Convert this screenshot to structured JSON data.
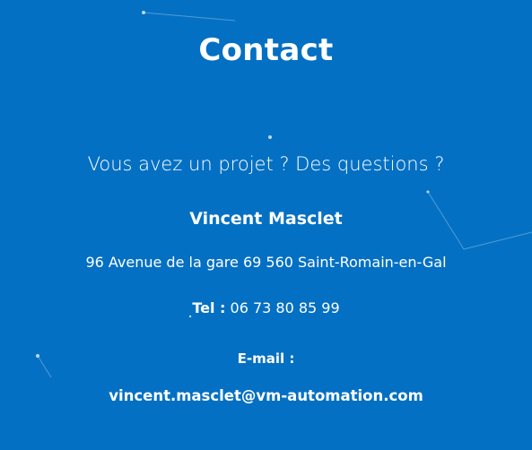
{
  "section": {
    "title": "Contact",
    "subtitle": "Vous avez un projet ? Des questions ?",
    "name": "Vincent Masclet",
    "address": "96 Avenue de la gare 69 560 Saint-Romain-en-Gal",
    "phone_label": "Tel :",
    "phone_value": "06 73 80 85 99",
    "email_label": "E-mail :",
    "email_value": "vincent.masclet@vm-automation.com"
  },
  "colors": {
    "background": "#0470c3",
    "text": "#ffffff"
  }
}
